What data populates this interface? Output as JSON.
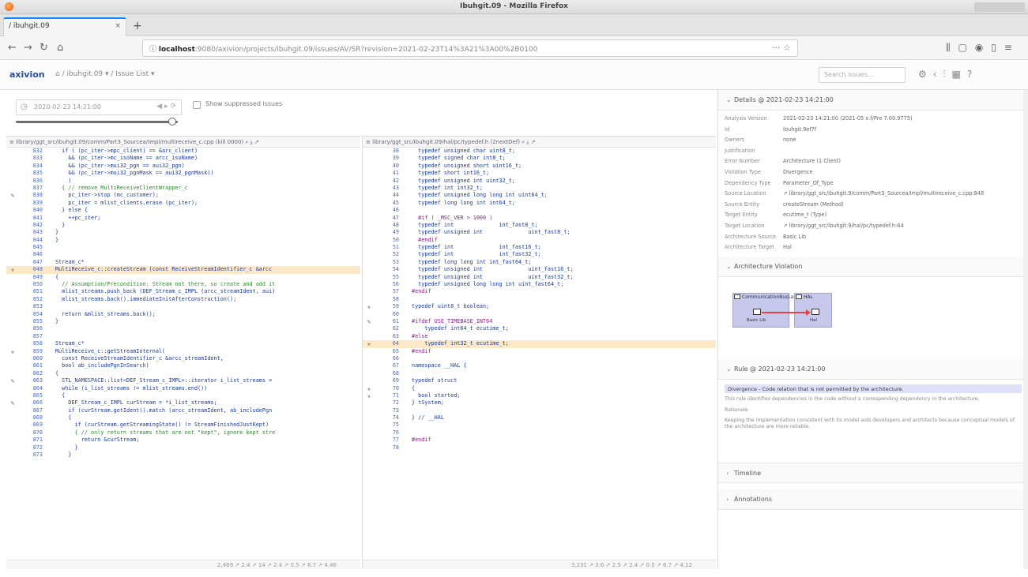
{
  "window": {
    "title": "Ibuhgit.09 - Mozilla Firefox"
  },
  "browser": {
    "tab_title": "/ ibuhgit.09",
    "url_host": "localhost",
    "url_rest": ":9080/axivion/projects/ibuhgit.09/issues/AV/SR?revision=2021-02-23T14%3A21%3A00%2B0100"
  },
  "app": {
    "logo": "axivion",
    "breadcrumb": "⌂ / ibuhgit.09 ▾ / Issue List ▾",
    "search_placeholder": "Search issues..."
  },
  "controls": {
    "date": "2020-02-23 14:21:00",
    "checkbox_label": "Show suppressed issues"
  },
  "left_pane": {
    "path": "≡ library/ggt_src/ibuhgit.09/comm/Part3_Sourcea/Impl/multireceive_c.cpp (kill 0000) ⌕ ⤓ ↗",
    "footer": "2,469 ↗ 2.4 ↗ 14 ↗ 2.4 ↗ 0.5 ↗ 6.7 ↗ 4.46",
    "lines": [
      {
        "n": "832",
        "m": "",
        "t": "  if ( (pc_iter->mpc_client) == &arc_client)",
        "c": ""
      },
      {
        "n": "833",
        "m": "",
        "t": "    && (pc_iter->mc_isoName == arcc_isoName)",
        "c": ""
      },
      {
        "n": "834",
        "m": "",
        "t": "    && (pc_iter->mui32_pgn == aui32_pgn)",
        "c": ""
      },
      {
        "n": "835",
        "m": "",
        "t": "    && (pc_iter->mui32_pgnMask == aui32_pgnMask))",
        "c": ""
      },
      {
        "n": "836",
        "m": "",
        "t": "    )",
        "c": ""
      },
      {
        "n": "837",
        "m": "",
        "t": "  { // remove MultiReceiveClientWrapper_c",
        "c": "cm"
      },
      {
        "n": "838",
        "m": "✎",
        "t": "    pc_iter->stop (mc_customer);",
        "c": ""
      },
      {
        "n": "839",
        "m": "",
        "t": "    pc_iter = mlist_clients.erase (pc_iter);",
        "c": ""
      },
      {
        "n": "840",
        "m": "",
        "t": "  } else {",
        "c": ""
      },
      {
        "n": "841",
        "m": "",
        "t": "    ++pc_iter;",
        "c": ""
      },
      {
        "n": "842",
        "m": "",
        "t": "  }",
        "c": ""
      },
      {
        "n": "843",
        "m": "",
        "t": "}",
        "c": ""
      },
      {
        "n": "844",
        "m": "",
        "t": "}",
        "c": ""
      },
      {
        "n": "845",
        "m": "",
        "t": "",
        "c": ""
      },
      {
        "n": "846",
        "m": "",
        "t": "",
        "c": ""
      },
      {
        "n": "847",
        "m": "",
        "t": "Stream_c*",
        "c": ""
      },
      {
        "n": "848",
        "m": "☣",
        "t": "MultiReceive_c::createStream (const ReceiveStreamIdentifier_c &arcc",
        "c": "hl"
      },
      {
        "n": "849",
        "m": "",
        "t": "{",
        "c": ""
      },
      {
        "n": "850",
        "m": "",
        "t": "  // Assumption/Precondition: Stream not there, so create and add it",
        "c": "cm"
      },
      {
        "n": "851",
        "m": "",
        "t": "  mlist_streams.push_back (DEF_Stream_c_IMPL (arcc_streamIdent, aui)",
        "c": ""
      },
      {
        "n": "852",
        "m": "",
        "t": "  mlist_streams.back().immediateInitAfterConstruction();",
        "c": ""
      },
      {
        "n": "853",
        "m": "",
        "t": "",
        "c": ""
      },
      {
        "n": "854",
        "m": "",
        "t": "  return &mlist_streams.back();",
        "c": ""
      },
      {
        "n": "855",
        "m": "",
        "t": "}",
        "c": ""
      },
      {
        "n": "856",
        "m": "",
        "t": "",
        "c": ""
      },
      {
        "n": "857",
        "m": "",
        "t": "",
        "c": ""
      },
      {
        "n": "858",
        "m": "",
        "t": "Stream_c*",
        "c": ""
      },
      {
        "n": "859",
        "m": "☣",
        "t": "MultiReceive_c::getStreamInternal(",
        "c": ""
      },
      {
        "n": "860",
        "m": "",
        "t": "  const ReceiveStreamIdentifier_c &arcc_streamIdent,",
        "c": ""
      },
      {
        "n": "861",
        "m": "",
        "t": "  bool ab_includePgnInSearch)",
        "c": ""
      },
      {
        "n": "862",
        "m": "",
        "t": "{",
        "c": ""
      },
      {
        "n": "863",
        "m": "✎",
        "t": "  STL_NAMESPACE::list<DEF_Stream_c_IMPL>::iterator i_list_streams =",
        "c": ""
      },
      {
        "n": "864",
        "m": "",
        "t": "  while (i_list_streams != mlist_streams.end())",
        "c": ""
      },
      {
        "n": "865",
        "m": "",
        "t": "  {",
        "c": ""
      },
      {
        "n": "866",
        "m": "✎",
        "t": "    DEF_Stream_c_IMPL curStream = *i_list_streams;",
        "c": ""
      },
      {
        "n": "867",
        "m": "",
        "t": "    if (curStream.getIdent().match (arcc_streamIdent, ab_includePgn",
        "c": ""
      },
      {
        "n": "868",
        "m": "",
        "t": "    {",
        "c": ""
      },
      {
        "n": "869",
        "m": "",
        "t": "      if (curStream.getStreamingState() != StreamFinishedJustKept)",
        "c": ""
      },
      {
        "n": "870",
        "m": "",
        "t": "      { // only return streams that are not \"kept\", ignore kept stre",
        "c": "cm"
      },
      {
        "n": "871",
        "m": "",
        "t": "        return &curStream;",
        "c": ""
      },
      {
        "n": "872",
        "m": "",
        "t": "      }",
        "c": ""
      },
      {
        "n": "873",
        "m": "",
        "t": "    }",
        "c": ""
      }
    ]
  },
  "right_pane": {
    "path": "≡ library/ggt_src/ibuhgit.09/hal/pc/typedef.h (2nextDef) ⌕ ⤓ ↗",
    "footer": "3,231 ↗ 3.6 ↗ 2.5 ↗ 2.4 ↗ 0.5 ↗ 6.7 ↗ 4.12",
    "lines": [
      {
        "n": "38",
        "m": "",
        "t": "  typedef unsigned char uint8_t;",
        "c": ""
      },
      {
        "n": "39",
        "m": "",
        "t": "  typedef signed char int8_t;",
        "c": ""
      },
      {
        "n": "40",
        "m": "",
        "t": "  typedef unsigned short uint16_t;",
        "c": ""
      },
      {
        "n": "41",
        "m": "",
        "t": "  typedef short int16_t;",
        "c": ""
      },
      {
        "n": "42",
        "m": "",
        "t": "  typedef unsigned int uint32_t;",
        "c": ""
      },
      {
        "n": "43",
        "m": "",
        "t": "  typedef int int32_t;",
        "c": ""
      },
      {
        "n": "44",
        "m": "",
        "t": "  typedef unsigned long long int uint64_t;",
        "c": ""
      },
      {
        "n": "45",
        "m": "",
        "t": "  typedef long long int int64_t;",
        "c": ""
      },
      {
        "n": "46",
        "m": "",
        "t": "",
        "c": ""
      },
      {
        "n": "47",
        "m": "",
        "t": "  #if ( _MSC_VER > 1000 )",
        "c": "kw"
      },
      {
        "n": "48",
        "m": "",
        "t": "  typedef int              int_fast8_t;",
        "c": ""
      },
      {
        "n": "49",
        "m": "",
        "t": "  typedef unsigned int              uint_fast8_t;",
        "c": ""
      },
      {
        "n": "50",
        "m": "",
        "t": "  #endif",
        "c": "kw"
      },
      {
        "n": "51",
        "m": "",
        "t": "  typedef int              int_fast16_t;",
        "c": ""
      },
      {
        "n": "52",
        "m": "",
        "t": "  typedef int              int_fast32_t;",
        "c": ""
      },
      {
        "n": "53",
        "m": "",
        "t": "  typedef long long int int_fast64_t;",
        "c": ""
      },
      {
        "n": "54",
        "m": "",
        "t": "  typedef unsigned int              uint_fast16_t;",
        "c": ""
      },
      {
        "n": "55",
        "m": "",
        "t": "  typedef unsigned int              uint_fast32_t;",
        "c": ""
      },
      {
        "n": "56",
        "m": "",
        "t": "  typedef unsigned long long int uint_fast64_t;",
        "c": ""
      },
      {
        "n": "57",
        "m": "",
        "t": "#endif",
        "c": "kw"
      },
      {
        "n": "58",
        "m": "",
        "t": "",
        "c": ""
      },
      {
        "n": "59",
        "m": "☣",
        "t": "typedef uint8_t boolean;",
        "c": ""
      },
      {
        "n": "60",
        "m": "",
        "t": "",
        "c": ""
      },
      {
        "n": "61",
        "m": "✎",
        "t": "#ifdef USE_TIMEBASE_INT64",
        "c": "kw"
      },
      {
        "n": "62",
        "m": "",
        "t": "    typedef int64_t ecutime_t;",
        "c": ""
      },
      {
        "n": "63",
        "m": "",
        "t": "#else",
        "c": "kw"
      },
      {
        "n": "64",
        "m": "☣",
        "t": "    typedef int32_t ecutime_t;",
        "c": "hl"
      },
      {
        "n": "65",
        "m": "",
        "t": "#endif",
        "c": "kw"
      },
      {
        "n": "66",
        "m": "",
        "t": "",
        "c": ""
      },
      {
        "n": "67",
        "m": "",
        "t": "namespace __HAL {",
        "c": ""
      },
      {
        "n": "68",
        "m": "",
        "t": "",
        "c": ""
      },
      {
        "n": "69",
        "m": "",
        "t": "typedef struct",
        "c": ""
      },
      {
        "n": "70",
        "m": "☣",
        "t": "{",
        "c": ""
      },
      {
        "n": "71",
        "m": "☣",
        "t": "  bool started;",
        "c": ""
      },
      {
        "n": "72",
        "m": "",
        "t": "} tSystem;",
        "c": ""
      },
      {
        "n": "73",
        "m": "",
        "t": "",
        "c": ""
      },
      {
        "n": "74",
        "m": "",
        "t": "} // __HAL",
        "c": ""
      },
      {
        "n": "75",
        "m": "",
        "t": "",
        "c": ""
      },
      {
        "n": "76",
        "m": "",
        "t": "",
        "c": ""
      },
      {
        "n": "77",
        "m": "",
        "t": "#endif",
        "c": "kw"
      },
      {
        "n": "78",
        "m": "",
        "t": "",
        "c": ""
      }
    ]
  },
  "details": {
    "header": "Details @ 2021-02-23 14:21:00",
    "rows": [
      {
        "k": "Analysis Version",
        "v": "2021-02-23 14:21:00 (2021-05 x.f/Pre 7.00.9775)"
      },
      {
        "k": "Id",
        "v": "ibuhgit.9ef7f"
      },
      {
        "k": "Owners",
        "v": "none"
      },
      {
        "k": "Justification",
        "v": ""
      },
      {
        "k": "Error Number",
        "v": "Architecture (1 Client)"
      },
      {
        "k": "Violation Type",
        "v": "Divergence"
      },
      {
        "k": "Dependency Type",
        "v": "Parameter_Of_Type"
      },
      {
        "k": "Source Location",
        "v": "↗ library/ggt_src/ibuhgit.9/comm/Part3_Sourcea/Impl/multireceive_c.cpp:848"
      },
      {
        "k": "Source Entity",
        "v": "createStream (Method)"
      },
      {
        "k": "Target Entity",
        "v": "ecutime_t (Type)"
      },
      {
        "k": "Target Location",
        "v": "↗ library/ggt_src/ibuhgit.9/hal/pc/typedef.h:64"
      },
      {
        "k": "Architecture Source",
        "v": "Basic Lib"
      },
      {
        "k": "Architecture Target",
        "v": "Hal"
      }
    ],
    "arch_header": "Architecture Violation",
    "diagram": {
      "comp1": "CommunicationBusLayer",
      "comp1_node": "Basic Lib",
      "comp2": "HAL",
      "comp2_node": "Hal"
    },
    "rule_header": "Rule @ 2021-02-23 14:21:00",
    "rule_title": "Divergence - Code relation that is not permitted by the architecture.",
    "rule_text1": "This rule identifies dependencies in the code without a corresponding dependency in the architecture.",
    "rule_text2_title": "Rationale",
    "rule_text2": "Keeping the implementation consistent with its model aids developers and architects because conceptual models of the architecture are more reliable.",
    "timeline": "Timeline",
    "annotations": "Annotations"
  }
}
